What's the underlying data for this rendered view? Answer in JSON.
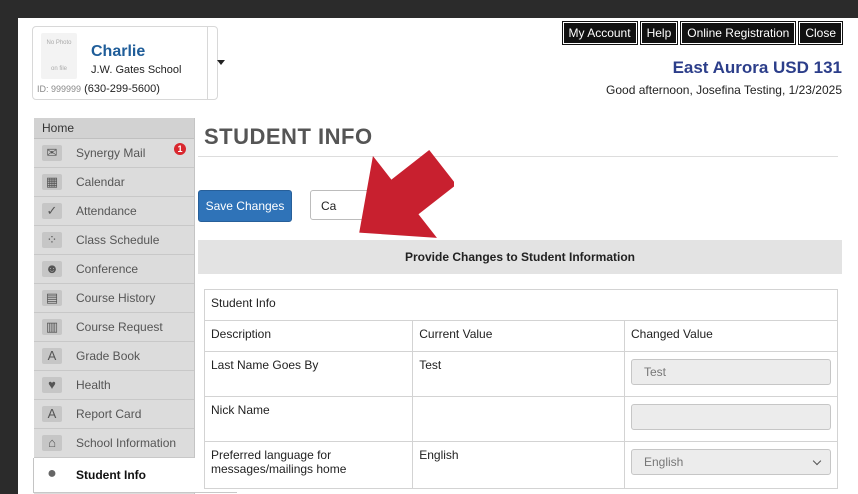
{
  "student": {
    "photo_text": [
      "No Photo",
      "on file"
    ],
    "name": "Charlie",
    "school": "J.W. Gates School",
    "id_label": "ID: 999999",
    "phone": "(630-299-5600)"
  },
  "top_buttons": [
    "My Account",
    "Help",
    "Online Registration",
    "Close"
  ],
  "district": "East Aurora USD 131",
  "greeting": "Good afternoon, Josefina Testing, 1/23/2025",
  "sidebar": {
    "home": "Home",
    "items": [
      {
        "label": "Synergy Mail",
        "icon": "mail-icon",
        "glyph": "✉",
        "badge": "1"
      },
      {
        "label": "Calendar",
        "icon": "calendar-icon",
        "glyph": "▦"
      },
      {
        "label": "Attendance",
        "icon": "attendance-check-icon",
        "glyph": "✓"
      },
      {
        "label": "Class Schedule",
        "icon": "class-schedule-icon",
        "glyph": "⁘"
      },
      {
        "label": "Conference",
        "icon": "conference-icon",
        "glyph": "☻"
      },
      {
        "label": "Course History",
        "icon": "course-history-icon",
        "glyph": "▤"
      },
      {
        "label": "Course Request",
        "icon": "course-request-icon",
        "glyph": "▥"
      },
      {
        "label": "Grade Book",
        "icon": "grade-book-icon",
        "glyph": "A"
      },
      {
        "label": "Health",
        "icon": "health-icon",
        "glyph": "♥"
      },
      {
        "label": "Report Card",
        "icon": "report-card-icon",
        "glyph": "A"
      },
      {
        "label": "School Information",
        "icon": "school-icon",
        "glyph": "⌂"
      },
      {
        "label": "Student Info",
        "icon": "student-icon",
        "glyph": "●",
        "active": true
      }
    ]
  },
  "main": {
    "title": "STUDENT INFO",
    "save_label": "Save Changes",
    "cancel_label": "Ca",
    "section_title": "Provide Changes to Student Information",
    "table": {
      "subhead": "Student Info",
      "columns": [
        "Description",
        "Current Value",
        "Changed Value"
      ],
      "rows": [
        {
          "description": "Last Name Goes By",
          "current": "Test",
          "changed": "Test",
          "type": "text"
        },
        {
          "description": "Nick Name",
          "current": "",
          "changed": "",
          "type": "text"
        },
        {
          "description": "Preferred language for messages/mailings home",
          "current": "English",
          "changed": "English",
          "type": "select"
        }
      ]
    }
  },
  "colors": {
    "accent": "#2f73b8",
    "district": "#2c3e8a",
    "name": "#1f5d99",
    "arrow": "#c8202f",
    "badge": "#d9272e"
  }
}
